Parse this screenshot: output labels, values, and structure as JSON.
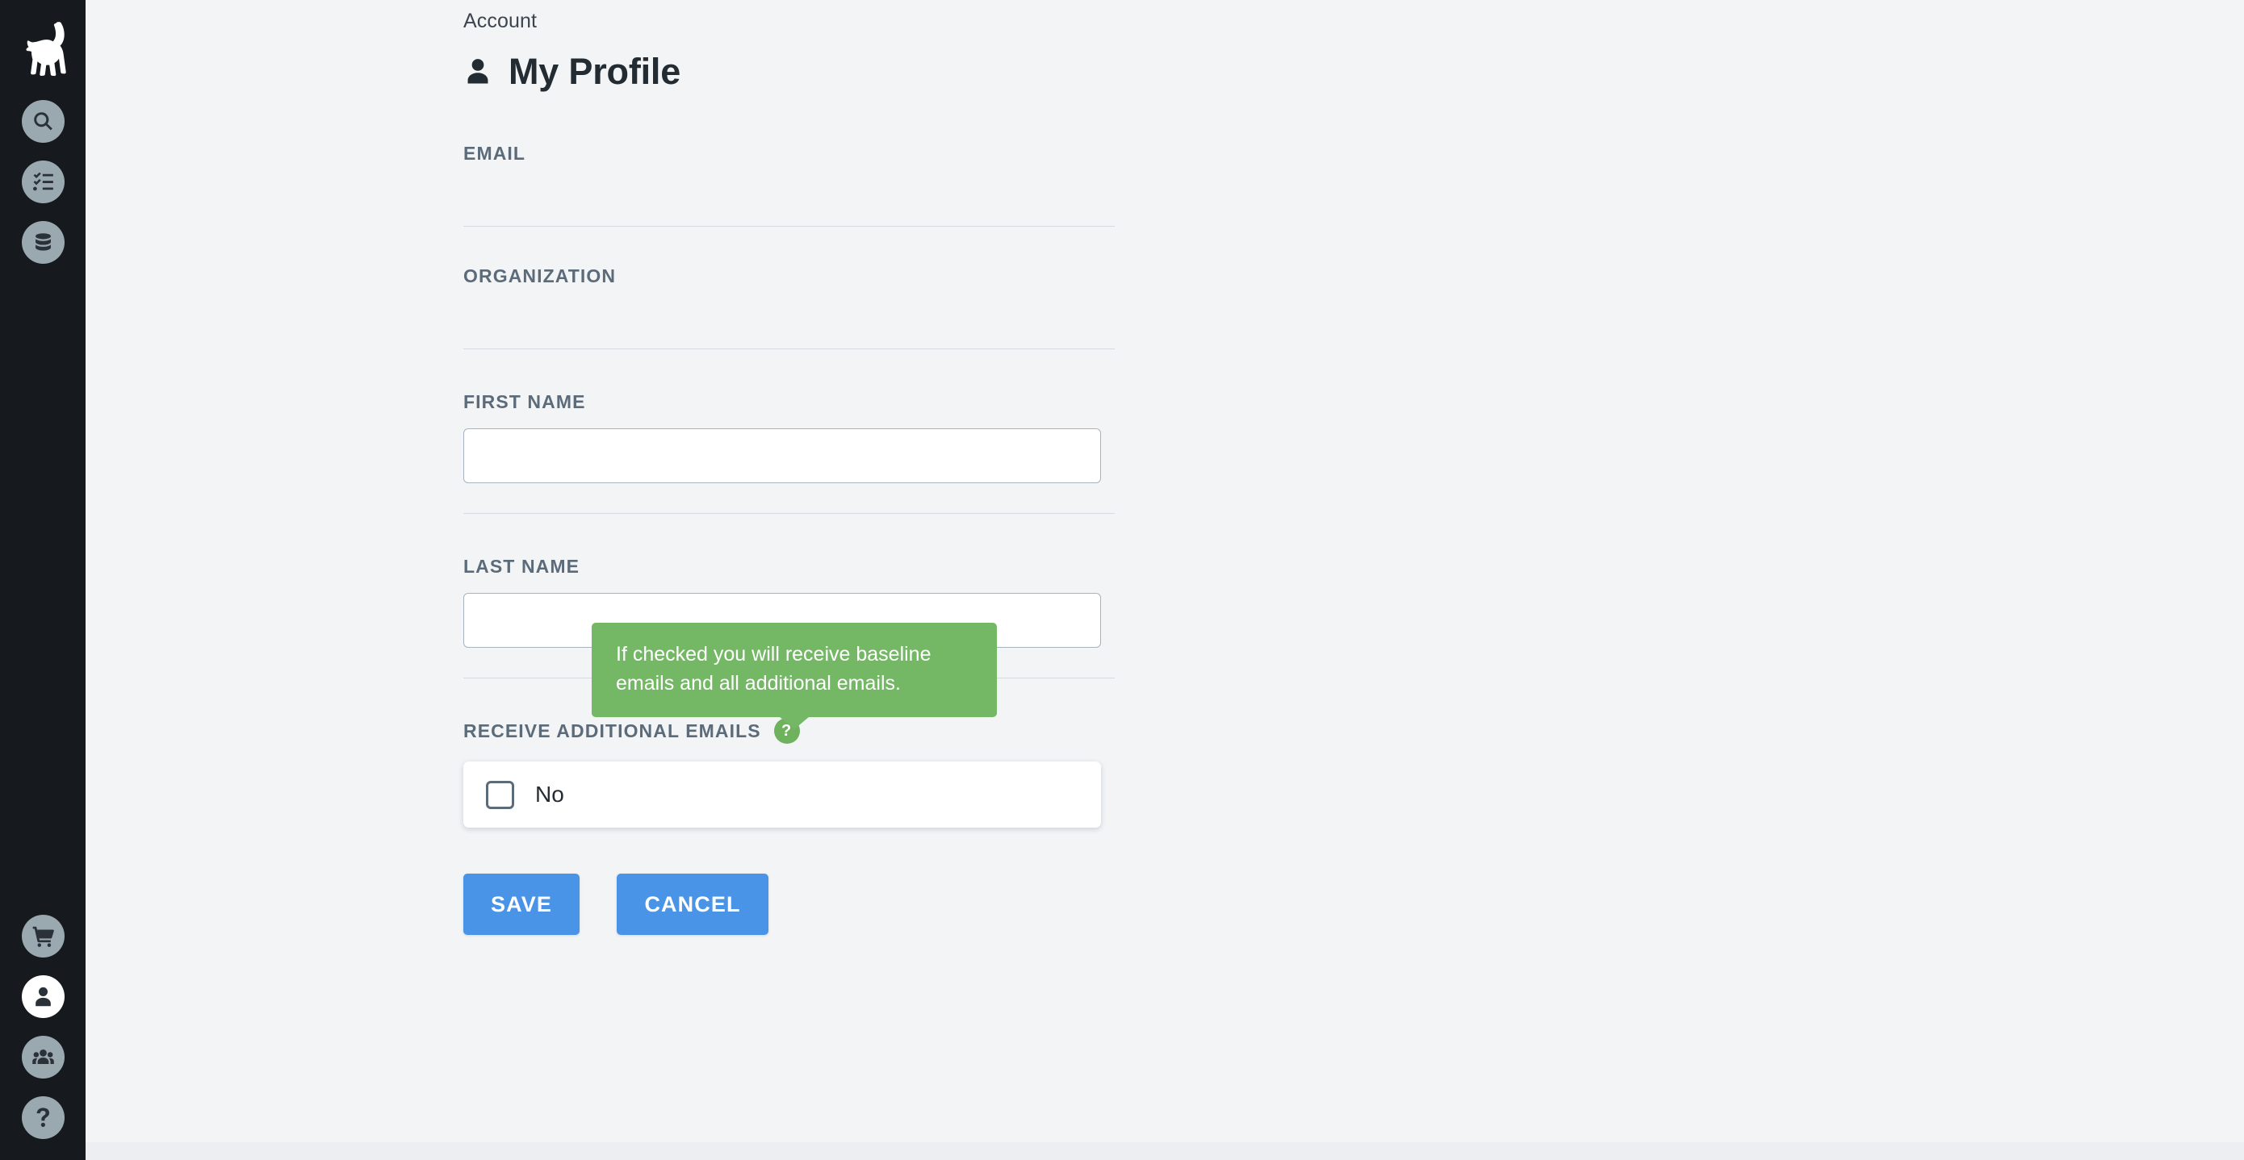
{
  "sidebar": {
    "logo": {
      "name": "ibex-logo"
    },
    "top_items": [
      {
        "icon": "search-icon",
        "name": "search"
      },
      {
        "icon": "checklist-icon",
        "name": "tasks"
      },
      {
        "icon": "database-icon",
        "name": "data"
      }
    ],
    "bottom_items": [
      {
        "icon": "cart-icon",
        "name": "cart",
        "active": false
      },
      {
        "icon": "user-icon",
        "name": "profile",
        "active": true
      },
      {
        "icon": "users-icon",
        "name": "teams",
        "active": false
      },
      {
        "icon": "question-icon",
        "name": "help",
        "active": false
      }
    ]
  },
  "header": {
    "breadcrumb": "Account",
    "title": "My Profile",
    "title_icon": "user-icon"
  },
  "form": {
    "email": {
      "label": "EMAIL",
      "value": ""
    },
    "organization": {
      "label": "ORGANIZATION",
      "value": ""
    },
    "first_name": {
      "label": "FIRST NAME",
      "value": "",
      "placeholder": ""
    },
    "last_name": {
      "label": "LAST NAME",
      "value": "",
      "placeholder": ""
    },
    "receive_additional_emails": {
      "label": "RECEIVE ADDITIONAL EMAILS",
      "help_badge": "?",
      "checkbox_label": "No",
      "checked": false
    },
    "tooltip": {
      "text": "If checked you will receive baseline emails and all additional emails.",
      "visible": true
    },
    "buttons": {
      "save": "SAVE",
      "cancel": "CANCEL"
    }
  },
  "colors": {
    "sidebar_bg": "#16191d",
    "page_bg": "#f2f4f6",
    "icon_bg": "#9aa8b0",
    "icon_active_bg": "#ffffff",
    "label": "#5c6b7a",
    "text": "#232b33",
    "accent_blue": "#4a94e8",
    "tooltip_green": "#74b866",
    "badge_green": "#6fb25e",
    "divider": "#d5dbe0",
    "input_border": "#a7b4bf"
  }
}
